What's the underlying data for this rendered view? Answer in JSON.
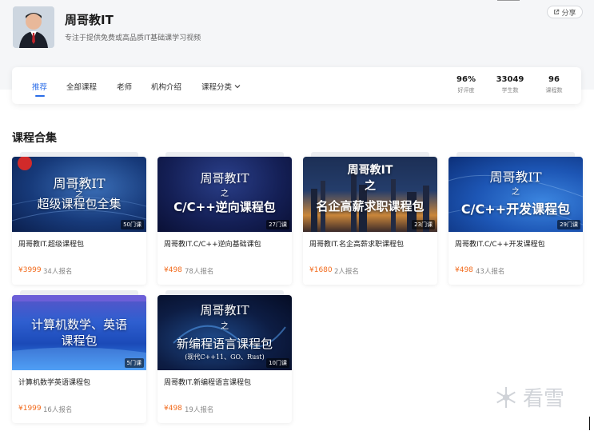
{
  "teacher": {
    "name": "周哥教IT",
    "description": "专注于提供免费或高品质IT基础课学习视频",
    "avatar_icon": "teacher-avatar-photo"
  },
  "share": {
    "icon": "share-external-icon",
    "label": "分享"
  },
  "nav": {
    "items": [
      {
        "label": "推荐",
        "active": true
      },
      {
        "label": "全部课程",
        "active": false
      },
      {
        "label": "老师",
        "active": false
      },
      {
        "label": "机构介绍",
        "active": false
      },
      {
        "label": "课程分类",
        "active": false,
        "dropdown": true
      }
    ],
    "dropdown_icon": "chevron-down-icon",
    "accent_color": "#2b6de8"
  },
  "stats": [
    {
      "value": "96%",
      "label": "好评度"
    },
    {
      "value": "33049",
      "label": "学生数"
    },
    {
      "value": "96",
      "label": "课程数"
    }
  ],
  "section": {
    "title": "课程合集"
  },
  "courses": [
    {
      "cover_lines": [
        "周哥教IT",
        "之",
        "超级课程包全集"
      ],
      "lesson_count": "50门课",
      "title": "周哥教IT.超级课程包",
      "price": "¥3999",
      "enrolled": "34人报名"
    },
    {
      "cover_lines": [
        "周哥教IT",
        "之",
        "C/C++逆向课程包"
      ],
      "lesson_count": "27门课",
      "title": "周哥教IT.C/C++逆向基础课包",
      "price": "¥498",
      "enrolled": "78人报名"
    },
    {
      "cover_lines": [
        "周哥教IT",
        "之",
        "名企高薪求职课程包"
      ],
      "lesson_count": "23门课",
      "title": "周哥教IT.名企高薪求职课程包",
      "price": "¥1680",
      "enrolled": "2人报名"
    },
    {
      "cover_lines": [
        "周哥教IT",
        "之",
        "C/C++开发课程包"
      ],
      "lesson_count": "29门课",
      "title": "周哥教IT.C/C++开发课程包",
      "price": "¥498",
      "enrolled": "43人报名"
    },
    {
      "cover_lines": [
        "计算机数学、英语",
        "课程包"
      ],
      "lesson_count": "5门课",
      "title": "计算机数学英语课程包",
      "price": "¥1999",
      "enrolled": "16人报名"
    },
    {
      "cover_lines": [
        "周哥教IT",
        "之",
        "新编程语言课程包",
        "(现代C++11、GO、Rust)"
      ],
      "lesson_count": "10门课",
      "title": "周哥教IT.新编程语言课程包",
      "price": "¥498",
      "enrolled": "19人报名"
    }
  ],
  "watermark": {
    "text": "看雪",
    "icon": "snowflake-logo-icon"
  },
  "colors": {
    "price": "#f26b1d",
    "header_bg": "#f5f6f8"
  }
}
